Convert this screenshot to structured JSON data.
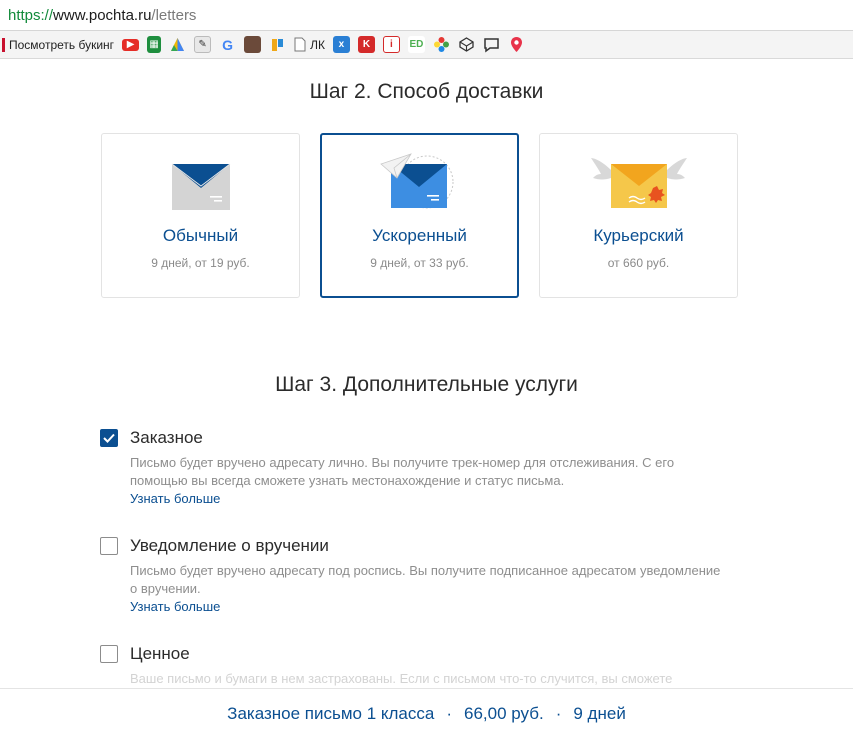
{
  "browser": {
    "url_scheme": "https://",
    "url_host": "www.pochta.ru",
    "url_path": "/letters"
  },
  "bookmarks": {
    "first_label": "Посмотреть букинг",
    "lk_label": "ЛК",
    "icons": [
      "youtube-icon",
      "sheets-icon",
      "triangle-icon",
      "script-icon",
      "google-icon",
      "photo-icon",
      "puzzle-icon",
      "doc-icon",
      "x-icon",
      "k-icon",
      "info-icon",
      "ed-icon",
      "flower-icon",
      "codepen-icon",
      "comment-icon",
      "pin-icon"
    ]
  },
  "step2": {
    "title": "Шаг 2. Способ доставки",
    "cards": [
      {
        "name": "Обычный",
        "sub": "9 дней, от 19 руб."
      },
      {
        "name": "Ускоренный",
        "sub": "9 дней, от 33 руб."
      },
      {
        "name": "Курьерский",
        "sub": "от 660 руб."
      }
    ],
    "selected_index": 1
  },
  "step3": {
    "title": "Шаг 3. Дополнительные услуги",
    "options": [
      {
        "title": "Заказное",
        "desc": "Письмо будет вручено адресату лично. Вы получите трек-номер для отслеживания. С его помощью вы всегда сможете узнать местонахождение и статус письма.",
        "link": "Узнать больше",
        "checked": true
      },
      {
        "title": "Уведомление о вручении",
        "desc": "Письмо будет вручено адресату под роспись. Вы получите подписанное адресатом уведомление о вручении.",
        "link": "Узнать больше",
        "checked": false
      },
      {
        "title": "Ценное",
        "desc": "Ваше письмо и бумаги в нем застрахованы. Если с письмом что-то случится, вы сможете",
        "checked": false
      }
    ]
  },
  "summary": {
    "type": "Заказное письмо 1 класса",
    "price": "66,00 руб.",
    "time": "9 дней",
    "separator": "·"
  },
  "colors": {
    "accent": "#0b4f91",
    "muted_text": "#8e8e8e",
    "envelope_blue": "#3d8ee2",
    "envelope_gray": "#d4d4d4",
    "envelope_yellow": "#f5c74a"
  }
}
